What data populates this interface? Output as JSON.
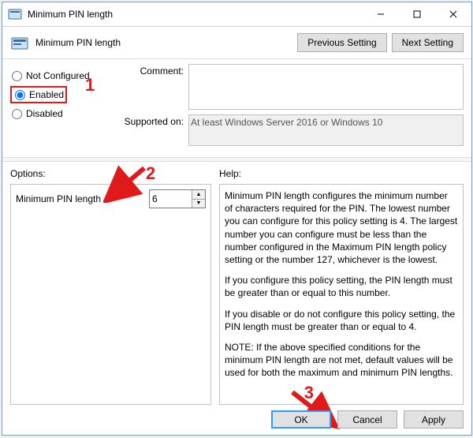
{
  "title": "Minimum PIN length",
  "header": {
    "title": "Minimum PIN length"
  },
  "nav": {
    "prev": "Previous Setting",
    "next": "Next Setting"
  },
  "state": {
    "not_configured": "Not Configured",
    "enabled": "Enabled",
    "disabled": "Disabled",
    "selected": "enabled"
  },
  "fields": {
    "comment_label": "Comment:",
    "comment_value": "",
    "supported_label": "Supported on:",
    "supported_value": "At least Windows Server 2016 or Windows 10"
  },
  "options": {
    "label": "Options:",
    "min_pin_label": "Minimum PIN length",
    "min_pin_value": "6"
  },
  "help": {
    "label": "Help:",
    "p1": "Minimum PIN length configures the minimum number of characters required for the PIN.  The lowest number you can configure for this policy setting is 4.  The largest number you can configure must be less than the number configured in the Maximum PIN length policy setting or the number 127, whichever is the lowest.",
    "p2": "If you configure this policy setting, the PIN length must be greater than or equal to this number.",
    "p3": "If you disable or do not configure this policy setting, the PIN length must be greater than or equal to 4.",
    "p4": "NOTE: If the above specified conditions for the minimum PIN length are not met, default values will be used for both the maximum and minimum PIN lengths."
  },
  "footer": {
    "ok": "OK",
    "cancel": "Cancel",
    "apply": "Apply"
  },
  "annotations": {
    "n1": "1",
    "n2": "2",
    "n3": "3"
  }
}
